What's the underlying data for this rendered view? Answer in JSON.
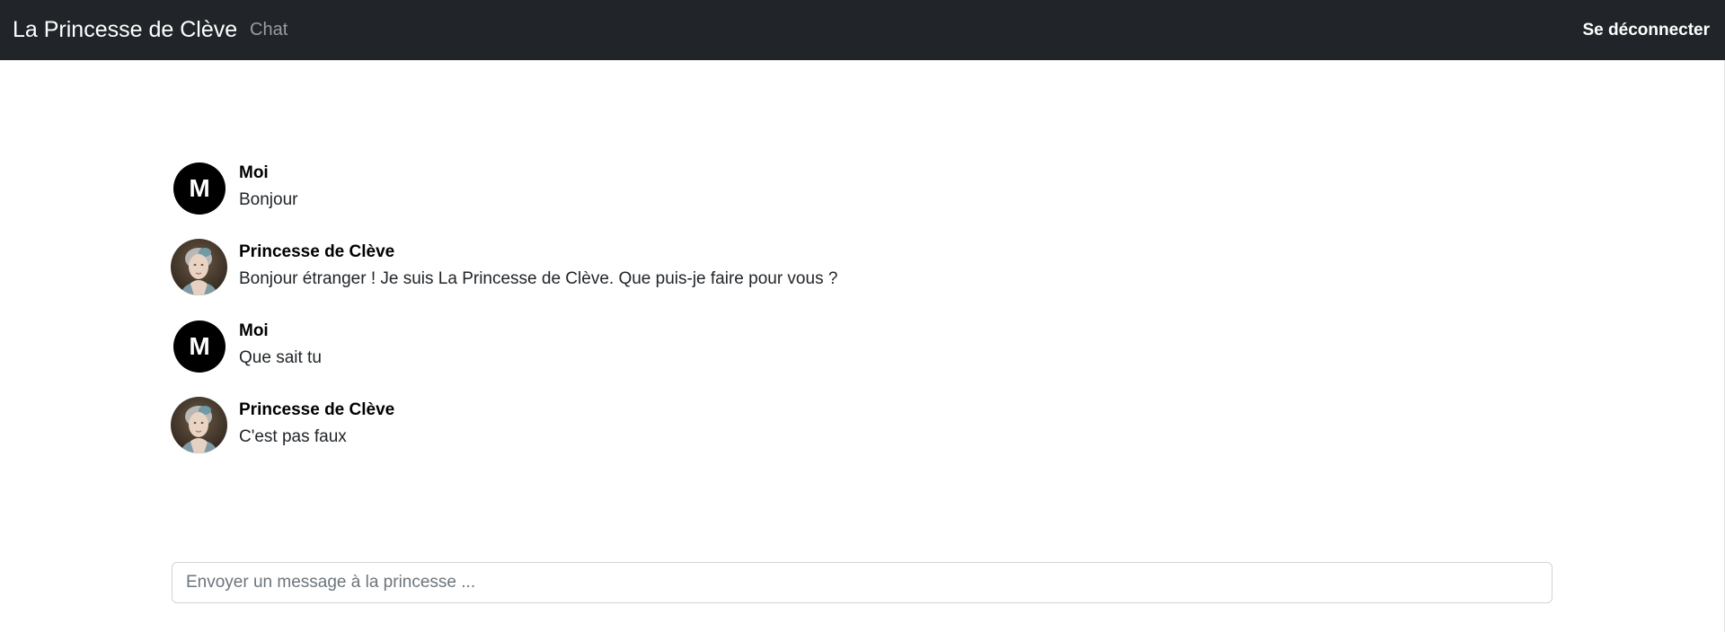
{
  "navbar": {
    "brand": "La Princesse de Clève",
    "chat_link": "Chat",
    "logout": "Se déconnecter"
  },
  "messages": [
    {
      "author": "Moi",
      "text": "Bonjour",
      "avatar": "letter",
      "avatar_letter": "M"
    },
    {
      "author": "Princesse de Clève",
      "text": "Bonjour étranger ! Je suis La Princesse de Clève. Que puis-je faire pour vous ?",
      "avatar": "portrait"
    },
    {
      "author": "Moi",
      "text": "Que sait tu",
      "avatar": "letter",
      "avatar_letter": "M"
    },
    {
      "author": "Princesse de Clève",
      "text": "C'est pas faux",
      "avatar": "portrait"
    }
  ],
  "composer": {
    "placeholder": "Envoyer un message à la princesse ...",
    "value": ""
  },
  "colors": {
    "navbar_bg": "#212529",
    "avatar_letter_bg": "#000000",
    "input_border": "#ced4da"
  }
}
